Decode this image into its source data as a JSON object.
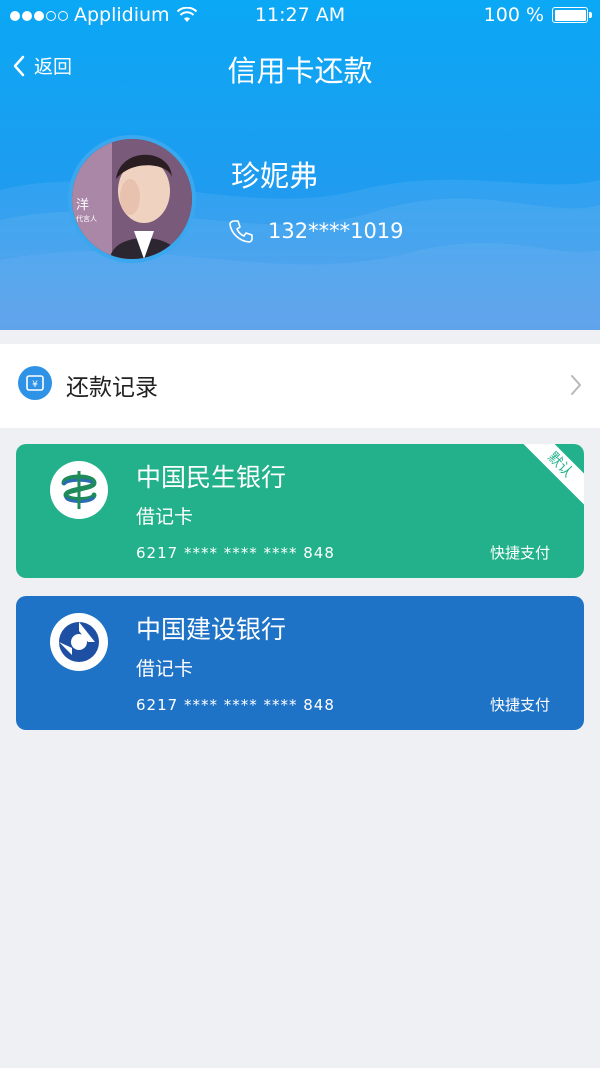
{
  "status_bar": {
    "carrier": "Applidium",
    "time": "11:27 AM",
    "battery": "100 %"
  },
  "nav": {
    "back_label": "返回",
    "title": "信用卡还款"
  },
  "profile": {
    "name": "珍妮弗",
    "phone": "132****1019",
    "avatar_text_1": "洋",
    "avatar_text_2": "代言人"
  },
  "records": {
    "label": "还款记录"
  },
  "cards": [
    {
      "bank": "中国民生银行",
      "type": "借记卡",
      "number": "6217 **** **** **** 848",
      "action": "快捷支付",
      "badge": "默认",
      "color": "#22b18a"
    },
    {
      "bank": "中国建设银行",
      "type": "借记卡",
      "number": "6217 **** **** **** 848",
      "action": "快捷支付",
      "color": "#1f73c6"
    }
  ],
  "colors": {
    "header_top": "#0aa8f5",
    "header_bottom": "#3d8fe8",
    "page_bg": "#eef0f4"
  }
}
